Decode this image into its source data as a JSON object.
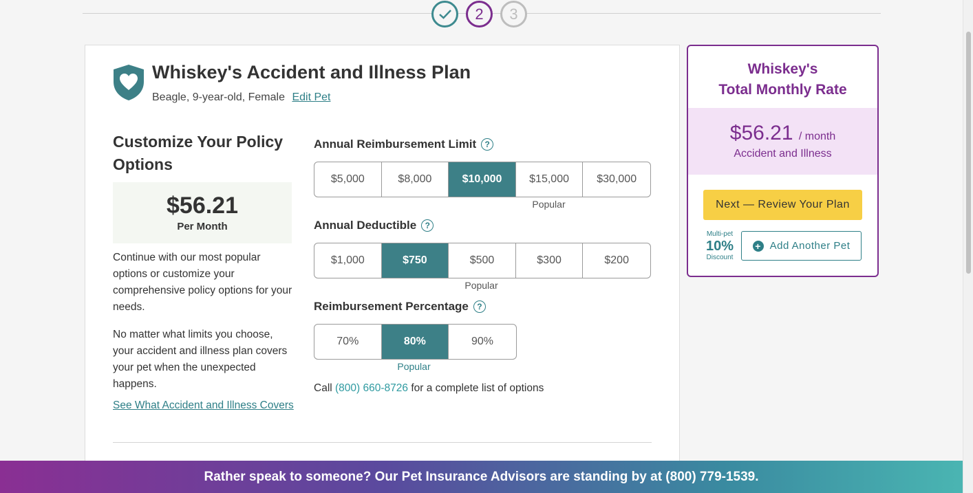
{
  "stepper": {
    "steps": [
      {
        "label": "✓",
        "state": "complete"
      },
      {
        "label": "2",
        "state": "current"
      },
      {
        "label": "3",
        "state": "upcoming"
      }
    ]
  },
  "plan": {
    "title": "Whiskey's Accident and Illness Plan",
    "pet_details": "Beagle, 9-year-old, Female",
    "edit_pet_label": "Edit Pet"
  },
  "customize": {
    "title": "Customize Your Policy Options",
    "price": "$56.21",
    "price_period": "Per Month",
    "description_1": "Continue with our most popular options or customize your comprehensive policy options for your needs.",
    "description_2": "No matter what limits you choose, your accident and illness plan covers your pet when the unexpected happens.",
    "covers_link": "See What Accident and Illness Covers"
  },
  "options": {
    "reimbursement_limit": {
      "label": "Annual Reimbursement Limit",
      "choices": [
        "$5,000",
        "$8,000",
        "$10,000",
        "$15,000",
        "$30,000"
      ],
      "selected": "$10,000",
      "popular_label": "Popular"
    },
    "deductible": {
      "label": "Annual Deductible",
      "choices": [
        "$1,000",
        "$750",
        "$500",
        "$300",
        "$200"
      ],
      "selected": "$750",
      "popular_label": "Popular"
    },
    "reimbursement_percentage": {
      "label": "Reimbursement Percentage",
      "choices": [
        "70%",
        "80%",
        "90%"
      ],
      "selected": "80%",
      "popular_label": "Popular"
    },
    "help_icon": "?",
    "call_prefix": "Call",
    "call_phone": "(800) 660-8726",
    "call_suffix": "for a complete list of options"
  },
  "summary": {
    "title_line_1": "Whiskey's",
    "title_line_2": "Total Monthly Rate",
    "price": "$56.21",
    "per_month": "/ month",
    "plan_type": "Accident and Illness",
    "next_button": "Next — Review Your Plan",
    "discount_top": "Multi-pet",
    "discount_value": "10%",
    "discount_bottom": "Discount",
    "add_pet_button": "Add Another Pet"
  },
  "banner": {
    "text": "Rather speak to someone? Our Pet Insurance Advisors are standing by at (800) 779-1539."
  },
  "colors": {
    "teal": "#3d8087",
    "purple": "#7b2d8e",
    "yellow": "#f7cf45",
    "lavender": "#f3e2f6"
  },
  "icons": [
    "check-icon",
    "shield-heart-icon",
    "help-icon",
    "plus-circle-icon"
  ]
}
